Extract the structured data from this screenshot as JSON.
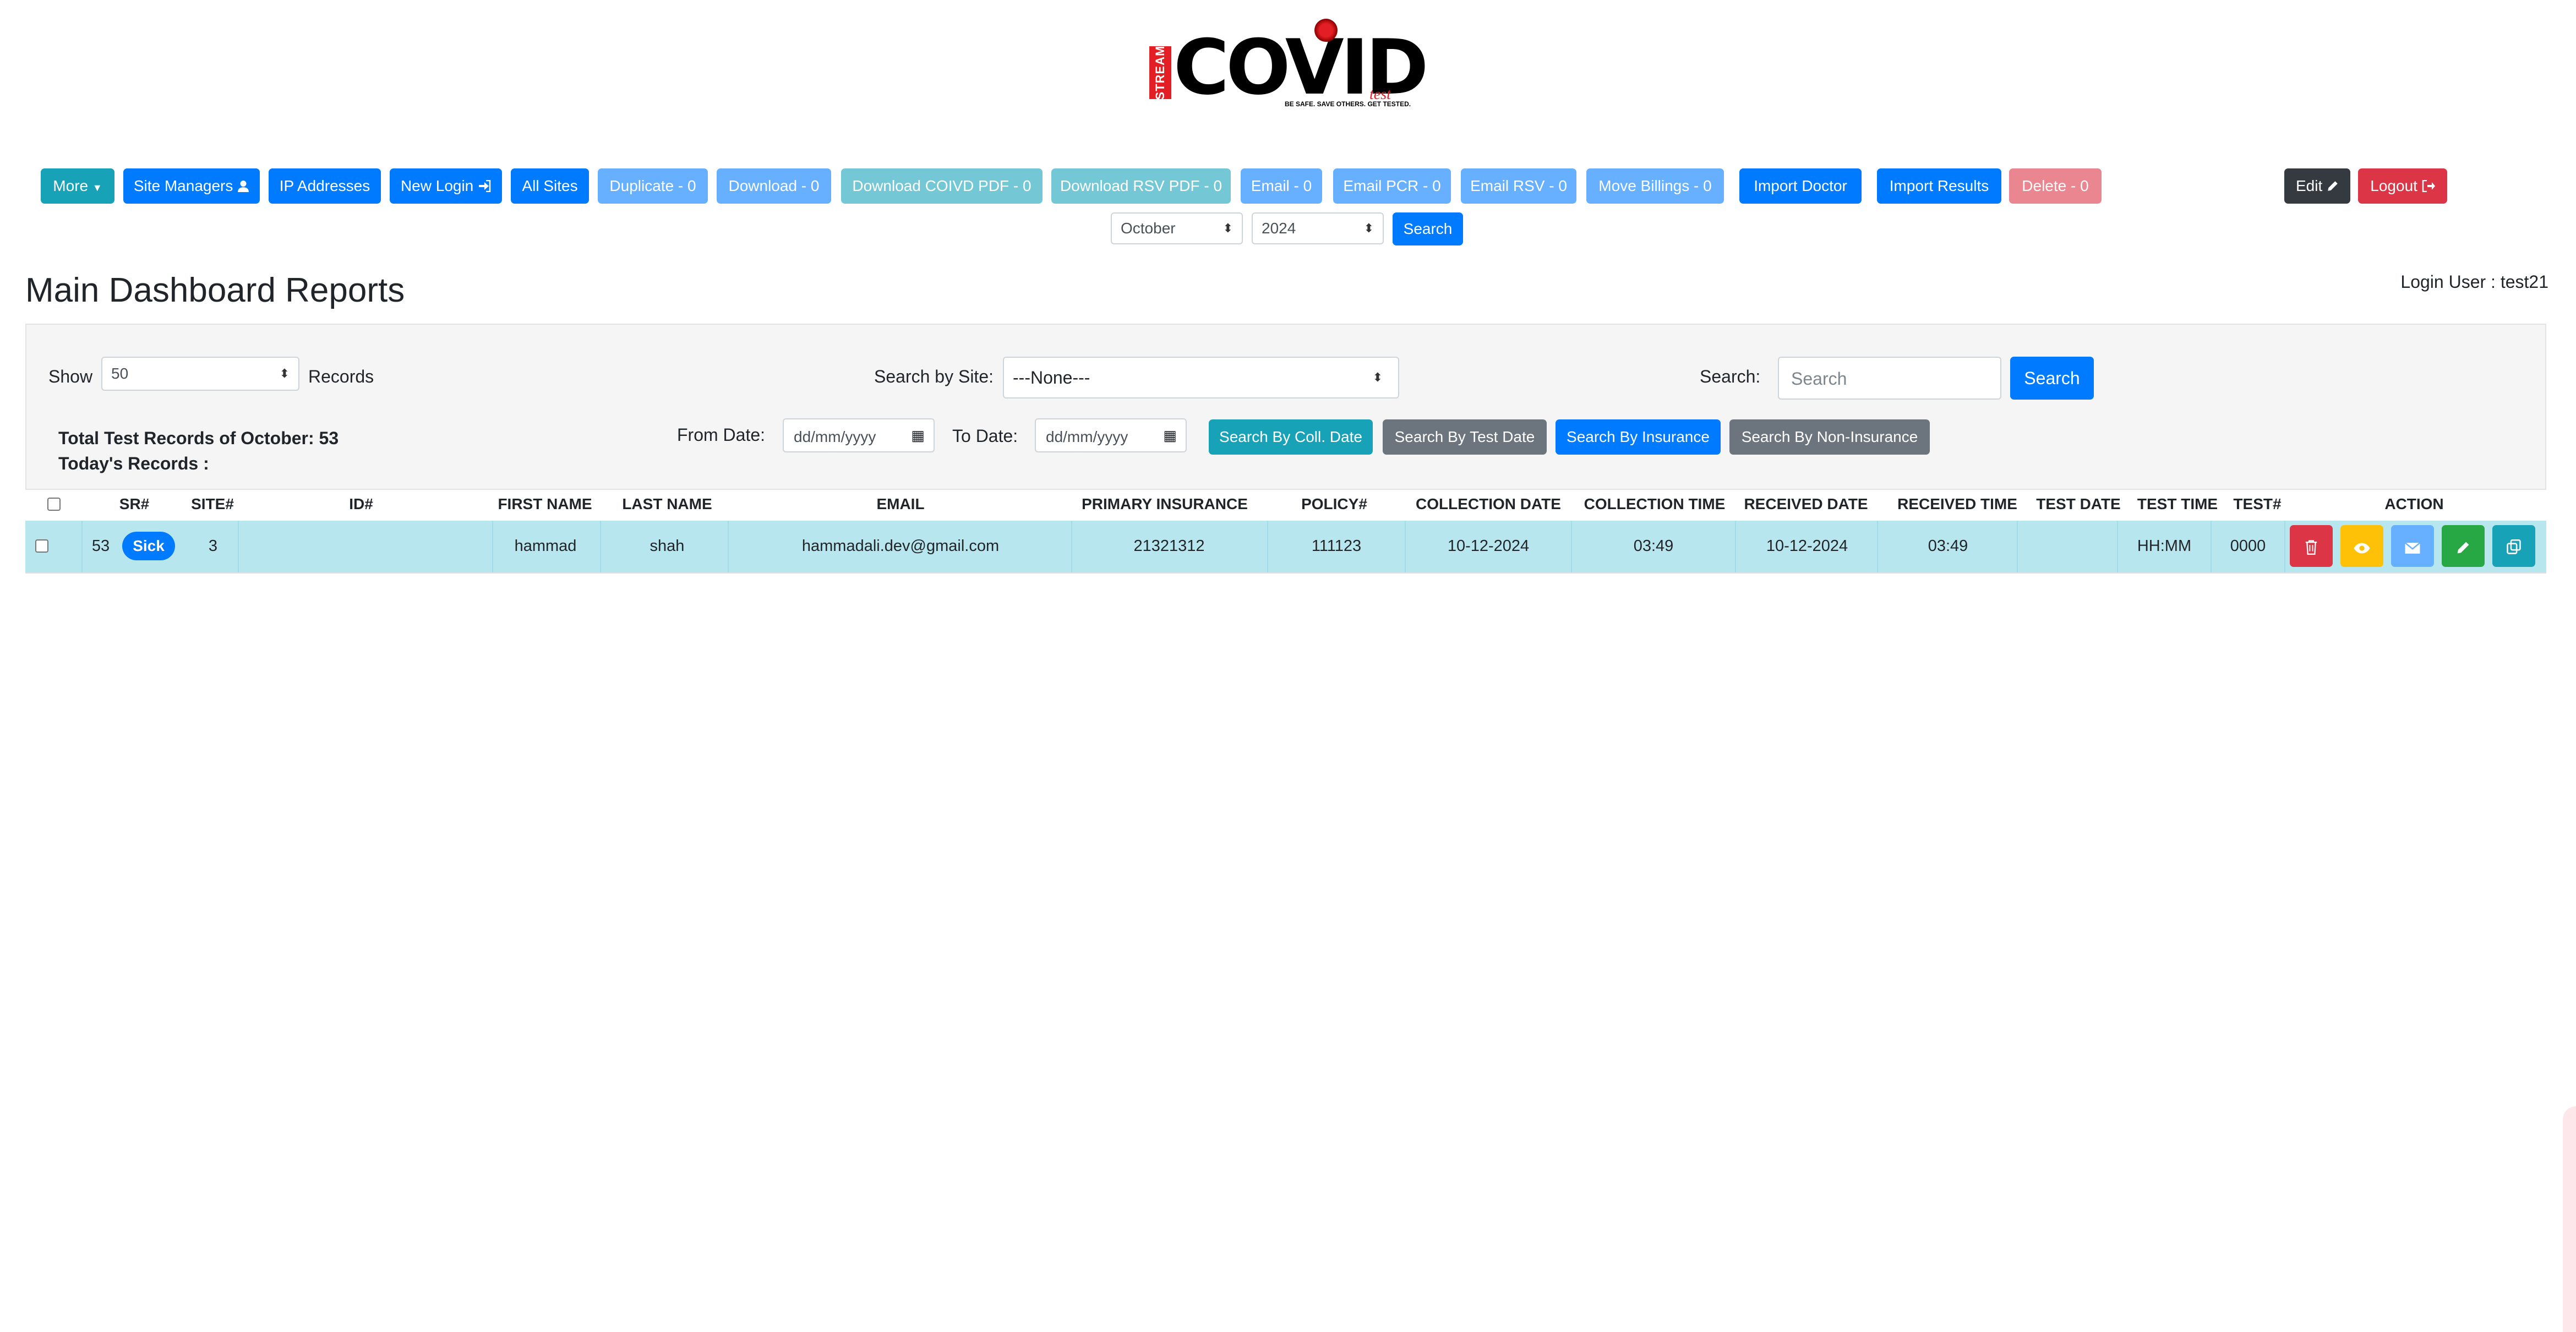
{
  "logo": {
    "stream": "STREAM",
    "covid": "COVID",
    "test": "test",
    "tagline": "BE SAFE. SAVE OTHERS. GET TESTED."
  },
  "toolbar": {
    "more": "More",
    "site_managers": "Site Managers",
    "ip_addresses": "IP Addresses",
    "new_login": "New Login",
    "all_sites": "All Sites",
    "duplicate": "Duplicate - 0",
    "download": "Download - 0",
    "download_covid_pdf": "Download COIVD PDF - 0",
    "download_rsv_pdf": "Download RSV PDF - 0",
    "email": "Email - 0",
    "email_pcr": "Email PCR - 0",
    "email_rsv": "Email RSV - 0",
    "move_billings": "Move Billings - 0",
    "import_doctor": "Import Doctor",
    "import_results": "Import Results",
    "delete": "Delete - 0",
    "edit": "Edit",
    "logout": "Logout"
  },
  "filter": {
    "month": "October",
    "year": "2024",
    "search": "Search"
  },
  "page": {
    "title": "Main Dashboard Reports",
    "login_user": "Login User : test21"
  },
  "controls": {
    "show_label": "Show",
    "show_value": "50",
    "records_label": "Records",
    "site_label": "Search by Site:",
    "site_value": "---None---",
    "search_label": "Search:",
    "search_placeholder": "Search",
    "search_button": "Search",
    "total_records": "Total Test Records of October: 53",
    "today_records": "Today's Records :",
    "from_date_label": "From Date:",
    "to_date_label": "To Date:",
    "date_placeholder": "dd/mm/yyyy",
    "btn_coll_date": "Search By Coll. Date",
    "btn_test_date": "Search By Test Date",
    "btn_insurance": "Search By Insurance",
    "btn_non_insurance": "Search By Non-Insurance"
  },
  "table": {
    "headers": [
      "SR#",
      "SITE#",
      "ID#",
      "FIRST NAME",
      "LAST NAME",
      "EMAIL",
      "PRIMARY INSURANCE",
      "POLICY#",
      "COLLECTION DATE",
      "COLLECTION TIME",
      "RECEIVED DATE",
      "RECEIVED TIME",
      "TEST DATE",
      "TEST TIME",
      "TEST#",
      "ACTION"
    ],
    "rows": [
      {
        "sr": "53",
        "status": "Sick",
        "site": "3",
        "id": "",
        "first_name": "hammad",
        "last_name": "shah",
        "email": "hammadali.dev@gmail.com",
        "primary_insurance": "21321312",
        "policy": "111123",
        "collection_date": "10-12-2024",
        "collection_time": "03:49",
        "received_date": "10-12-2024",
        "received_time": "03:49",
        "test_date": "",
        "test_time": "HH:MM",
        "test_no": "0000"
      }
    ]
  },
  "icons": {
    "user": "user-icon",
    "sign_in": "sign-in-icon",
    "pencil": "pencil-icon",
    "sign_out": "sign-out-icon",
    "trash": "trash-icon",
    "eye": "eye-icon",
    "envelope": "envelope-icon",
    "copy": "copy-icon"
  },
  "colors": {
    "primary": "#007bff",
    "info": "#17a2b8",
    "danger": "#dc3545",
    "success": "#28a745",
    "warning": "#ffc107",
    "row_highlight": "#b8e6ef"
  }
}
